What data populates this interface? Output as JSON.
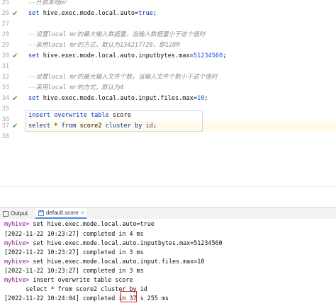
{
  "editor": {
    "line_numbers": [
      "25",
      "26",
      "27",
      "28",
      "29",
      "30",
      "31",
      "32",
      "33",
      "34",
      "35",
      "36",
      "37",
      "38"
    ],
    "checked_lines": [
      "26",
      "30",
      "34",
      "37"
    ],
    "lines": [
      {
        "type": "comment",
        "text": "--开启本地mr"
      },
      {
        "type": "set",
        "prefix": "set ",
        "key": "hive.exec.mode.local.auto",
        "eq": "=",
        "value": "true",
        "end": ";"
      },
      {
        "type": "blank",
        "text": ""
      },
      {
        "type": "comment",
        "text": "--设置local mr的最大输入数据量，当输入数据量小于这个值时"
      },
      {
        "type": "comment",
        "text": "--采用local mr的方式，默认为134217728，即128M"
      },
      {
        "type": "set",
        "prefix": "set ",
        "key": "hive.exec.mode.local.auto.inputbytes.max",
        "eq": "=",
        "value": "51234560",
        "end": ";"
      },
      {
        "type": "blank",
        "text": ""
      },
      {
        "type": "comment",
        "text": "--设置local mr的最大输入文件个数，当输入文件个数小于这个值时"
      },
      {
        "type": "comment",
        "text": "--采用local mr的方式，默认为4"
      },
      {
        "type": "set",
        "prefix": "set ",
        "key": "hive.exec.mode.local.auto.input.files.max",
        "eq": "=",
        "value": "10",
        "end": ";"
      },
      {
        "type": "blank",
        "text": ""
      },
      {
        "type": "blank",
        "text": ""
      },
      {
        "type": "sql1",
        "kw": "insert overwrite table",
        "rest": " score"
      },
      {
        "type": "sql2",
        "kw1": "select",
        "mid": " * ",
        "kw2": "from",
        "mid2": " score2 ",
        "kw3": "cluster by",
        "sp": " ",
        "col": "id",
        "end": ";"
      }
    ]
  },
  "tabs": {
    "output_label": "Output",
    "file_label": "default.score"
  },
  "console": {
    "lines": [
      {
        "prompt": "myhive>",
        "text": " set hive.exec.mode.local.auto=true"
      },
      {
        "prompt": "",
        "text": "[2022-11-22 10:23:27] completed in 4 ms"
      },
      {
        "prompt": "myhive>",
        "text": " set hive.exec.mode.local.auto.inputbytes.max=51234560"
      },
      {
        "prompt": "",
        "text": "[2022-11-22 10:23:27] completed in 3 ms"
      },
      {
        "prompt": "myhive>",
        "text": " set hive.exec.mode.local.auto.input.files.max=10"
      },
      {
        "prompt": "",
        "text": "[2022-11-22 10:23:27] completed in 3 ms"
      },
      {
        "prompt": "myhive>",
        "text": " insert overwrite table score"
      },
      {
        "prompt": "",
        "text": "      select * from score2 cluster by id"
      },
      {
        "prompt": "",
        "text": "[2022-11-22 10:24:04] completed in 37 s 255 ms"
      }
    ]
  },
  "colors": {
    "check": "#3fa83f",
    "highlight_box": "#e02020",
    "keyword": "#0033b3",
    "prompt": "#871094"
  }
}
